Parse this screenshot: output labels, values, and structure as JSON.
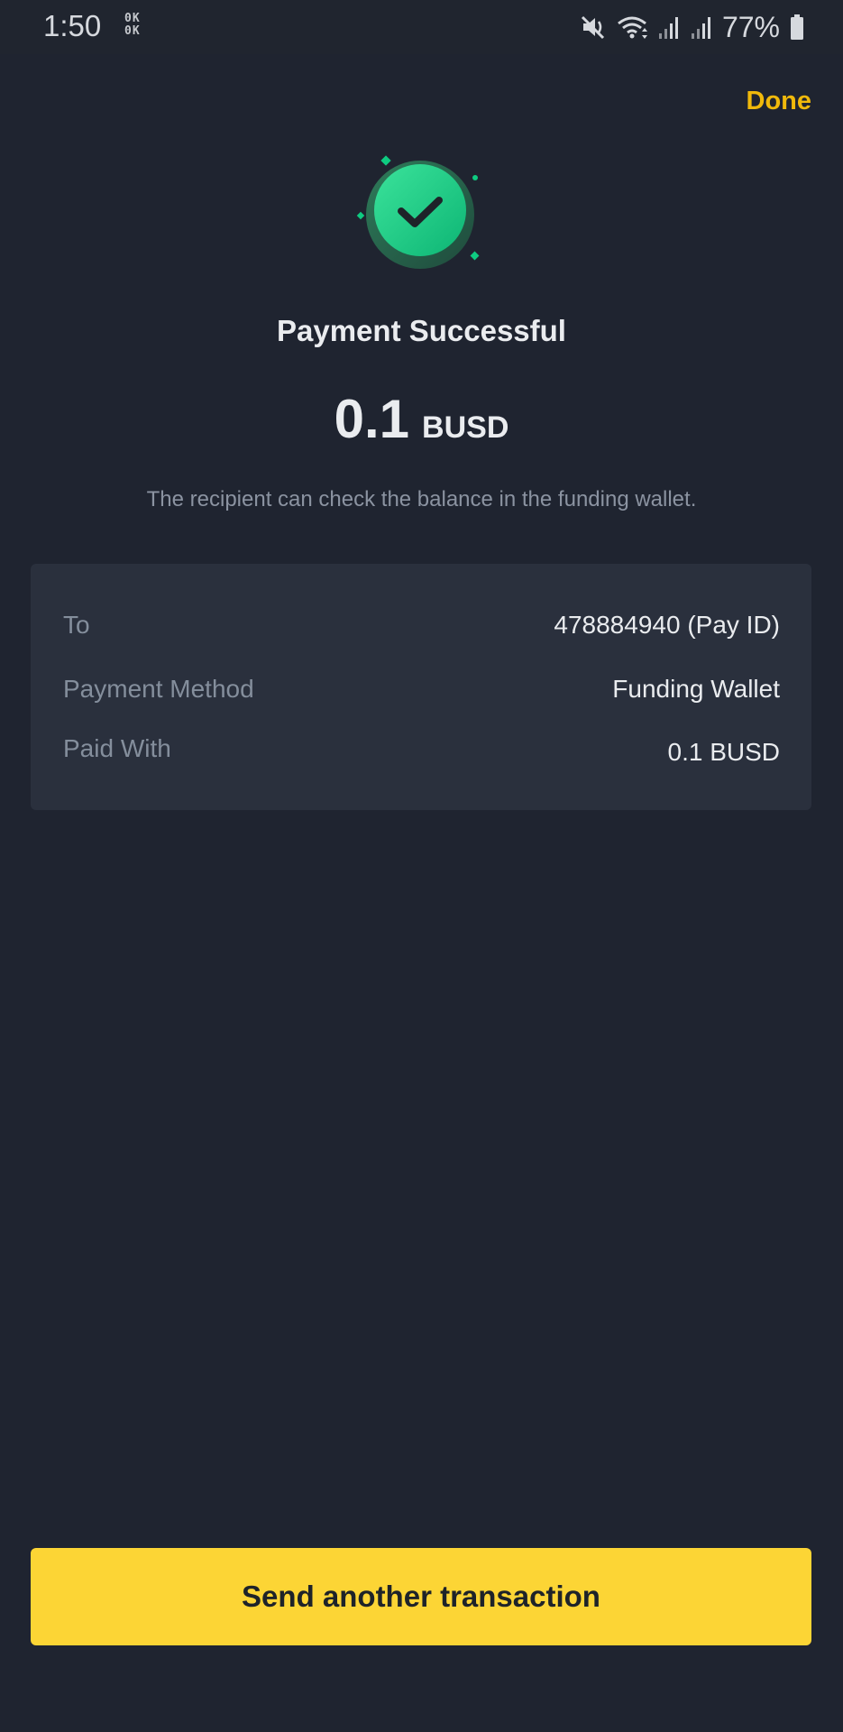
{
  "status_bar": {
    "time": "1:50",
    "indicator_top": "0K",
    "indicator_bottom": "0K",
    "battery": "77%"
  },
  "header": {
    "done_label": "Done"
  },
  "result": {
    "title": "Payment Successful",
    "amount": "0.1",
    "currency": "BUSD",
    "note": "The recipient can check the balance in the funding wallet."
  },
  "details": [
    {
      "label": "To",
      "value": "478884940 (Pay ID)"
    },
    {
      "label": "Payment Method",
      "value": "Funding Wallet"
    },
    {
      "label": "Paid With",
      "value": "0.1 BUSD"
    }
  ],
  "actions": {
    "send_another_label": "Send another transaction"
  },
  "colors": {
    "background": "#1f2430",
    "card": "#2a303d",
    "accent": "#f0b90b",
    "button": "#fcd535",
    "success": "#0ecb81"
  },
  "icons": {
    "success": "check-circle-icon",
    "mute": "mute-icon",
    "wifi": "wifi-icon",
    "signal": "signal-icon",
    "battery": "battery-icon"
  }
}
